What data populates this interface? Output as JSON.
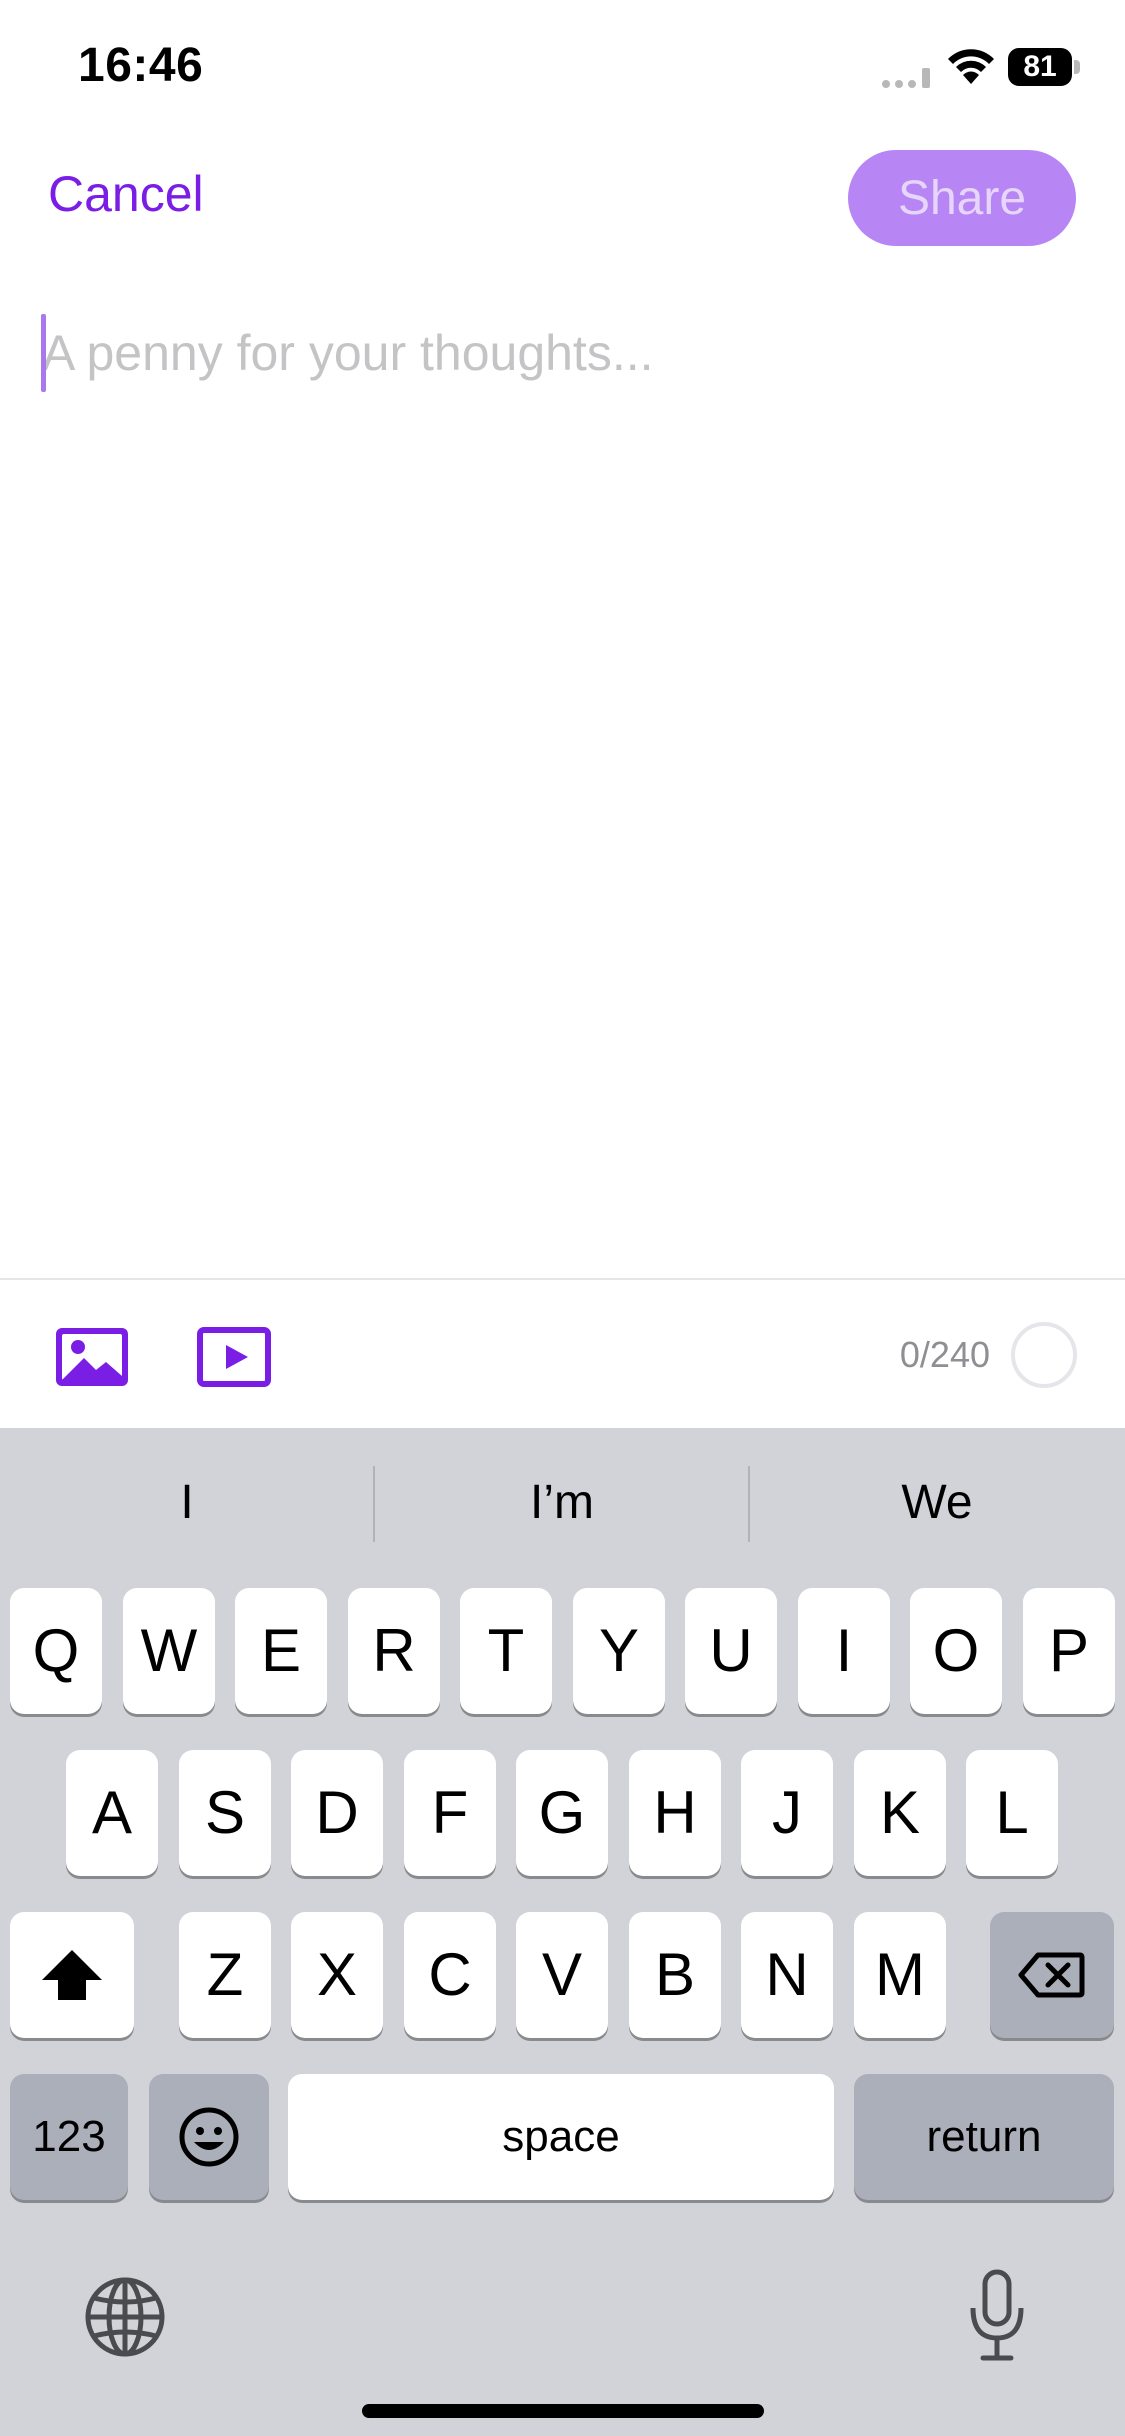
{
  "status_bar": {
    "time": "16:46",
    "battery_level": "81"
  },
  "header": {
    "cancel_label": "Cancel",
    "share_label": "Share"
  },
  "composer": {
    "placeholder": "A penny for your thoughts...",
    "value": ""
  },
  "toolbar": {
    "char_count": "0/240",
    "char_used": 0,
    "char_limit": 240
  },
  "keyboard": {
    "suggestions": [
      "I",
      "I’m",
      "We"
    ],
    "row1": [
      "Q",
      "W",
      "E",
      "R",
      "T",
      "Y",
      "U",
      "I",
      "O",
      "P"
    ],
    "row2": [
      "A",
      "S",
      "D",
      "F",
      "G",
      "H",
      "J",
      "K",
      "L"
    ],
    "row3": [
      "Z",
      "X",
      "C",
      "V",
      "B",
      "N",
      "M"
    ],
    "numbers_label": "123",
    "space_label": "space",
    "return_label": "return"
  },
  "colors": {
    "accent": "#7a1ee6",
    "share_disabled_bg": "#b885f5",
    "keyboard_bg": "#d1d3d9"
  }
}
